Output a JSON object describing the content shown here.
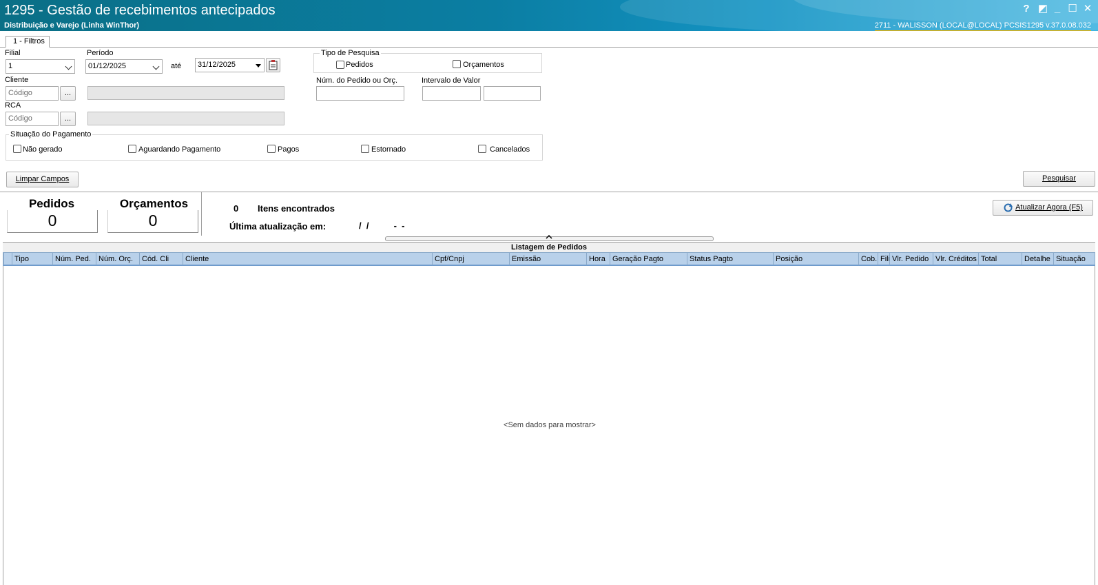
{
  "window": {
    "title": "1295 - Gestão de recebimentos antecipados",
    "subtitle": "Distribuição e Varejo (Linha WinThor)",
    "user_info": "2711 - WALISSON (LOCAL@LOCAL)   PCSIS1295  v.37.0.08.032",
    "controls": [
      "?",
      "◩",
      "_",
      "☐",
      "✕"
    ]
  },
  "tabs": [
    {
      "label": "1 - Filtros"
    }
  ],
  "filters": {
    "filial_label": "Filial",
    "filial_value": "1",
    "periodo_label": "Período",
    "periodo_start": "01/12/2025",
    "ate_label": "até",
    "periodo_end": "31/12/2025",
    "cliente_label": "Cliente",
    "cliente_placeholder": "Código",
    "rca_label": "RCA",
    "rca_placeholder": "Código",
    "ellipsis": "...",
    "tipo_pesquisa_title": "Tipo de Pesquisa",
    "tipo_pedidos": "Pedidos",
    "tipo_orcamentos": "Orçamentos",
    "num_pedido_label": "Núm. do Pedido ou Orç.",
    "intervalo_valor_label": "Intervalo de Valor",
    "situacao_title": "Situação do Pagamento",
    "situacao_options": [
      "Não gerado",
      "Aguardando Pagamento",
      "Pagos",
      "Estornado",
      "Cancelados"
    ],
    "limpar_button": "Limpar Campos",
    "pesquisar_button": "Pesquisar"
  },
  "summary": {
    "pedidos_label": "Pedidos",
    "pedidos_count": "0",
    "orcamentos_label": "Orçamentos",
    "orcamentos_count": "0",
    "itens_count": "0",
    "itens_label": "Itens encontrados",
    "ultima_label": "Última atualização em:",
    "ultima_value": "/  /          -  -",
    "atualizar_button": "Atualizar Agora (F5)"
  },
  "grid": {
    "title": "Listagem de Pedidos",
    "columns": [
      "Tipo",
      "Núm. Ped.",
      "Núm. Orç.",
      "Cód. Cli",
      "Cliente",
      "Cpf/Cnpj",
      "Emissão",
      "Hora",
      "Geração Pagto",
      "Status Pagto",
      "Posição",
      "Cob.",
      "Filia",
      "Vlr. Pedido",
      "Vlr. Créditos",
      "Total",
      "Detalhe",
      "Situação"
    ],
    "empty_text": "<Sem dados para mostrar>"
  },
  "colors": {
    "titlebar": "#0b7ea3",
    "grid_header": "#b9d1ea"
  }
}
